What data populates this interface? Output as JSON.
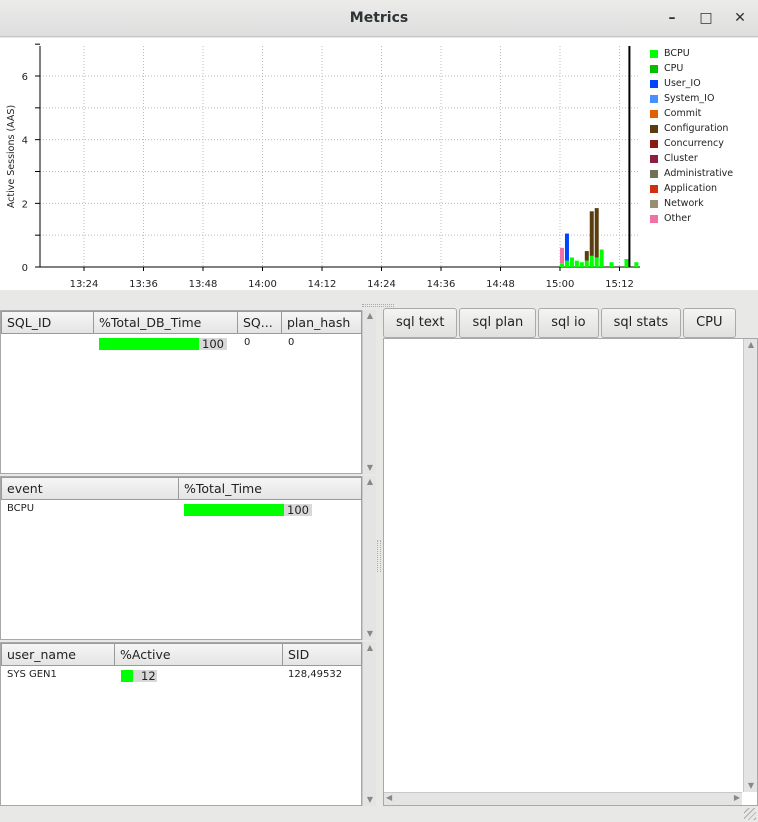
{
  "window": {
    "title": "Metrics",
    "minimize_glyph": "–",
    "maximize_glyph": "□",
    "close_glyph": "✕"
  },
  "chart_data": {
    "type": "bar",
    "title": "",
    "ylabel": "Active Sessions (AAS)",
    "xlabel": "",
    "ylim": [
      0,
      7
    ],
    "yticks": [
      0,
      2,
      4,
      6
    ],
    "xticks": [
      "13:24",
      "13:36",
      "13:48",
      "14:00",
      "14:12",
      "14:24",
      "14:36",
      "14:48",
      "15:00",
      "15:12"
    ],
    "legend": "right",
    "grid": true,
    "stacked": true,
    "series": [
      {
        "name": "BCPU",
        "color": "#00ff00"
      },
      {
        "name": "CPU",
        "color": "#00c000"
      },
      {
        "name": "User_IO",
        "color": "#0044ff"
      },
      {
        "name": "System_IO",
        "color": "#4a8fff"
      },
      {
        "name": "Commit",
        "color": "#e06000"
      },
      {
        "name": "Configuration",
        "color": "#5a3c10"
      },
      {
        "name": "Concurrency",
        "color": "#8b1a10"
      },
      {
        "name": "Cluster",
        "color": "#8b2040"
      },
      {
        "name": "Administrative",
        "color": "#707055"
      },
      {
        "name": "Application",
        "color": "#d03010"
      },
      {
        "name": "Network",
        "color": "#9a9070"
      },
      {
        "name": "Other",
        "color": "#f070a8"
      }
    ],
    "bars": [
      {
        "t": "15:00",
        "stack": {
          "Other": 0.5,
          "BCPU": 0.1
        }
      },
      {
        "t": "15:01",
        "stack": {
          "BCPU": 0.2,
          "User_IO": 0.85
        }
      },
      {
        "t": "15:02",
        "stack": {
          "BCPU": 0.3
        }
      },
      {
        "t": "15:03",
        "stack": {
          "BCPU": 0.2
        }
      },
      {
        "t": "15:04",
        "stack": {
          "BCPU": 0.15
        }
      },
      {
        "t": "15:05",
        "stack": {
          "BCPU": 0.2,
          "Configuration": 0.3
        }
      },
      {
        "t": "15:06",
        "stack": {
          "BCPU": 0.35,
          "Configuration": 1.4
        }
      },
      {
        "t": "15:07",
        "stack": {
          "BCPU": 0.3,
          "Configuration": 1.55
        }
      },
      {
        "t": "15:08",
        "stack": {
          "BCPU": 0.55
        }
      },
      {
        "t": "15:10",
        "stack": {
          "BCPU": 0.15
        }
      },
      {
        "t": "15:13",
        "stack": {
          "BCPU": 0.25
        }
      },
      {
        "t": "15:15",
        "stack": {
          "BCPU": 0.15
        }
      }
    ],
    "marker_time": "15:14"
  },
  "sql_table": {
    "headers": [
      "SQL_ID",
      "%Total_DB_Time",
      "SQ...",
      "plan_hash"
    ],
    "rows": [
      {
        "sql_id": "",
        "pct": 100,
        "pct_label": "100",
        "sq": "0",
        "plan_hash": "0"
      }
    ]
  },
  "event_table": {
    "headers": [
      "event",
      "%Total_Time"
    ],
    "rows": [
      {
        "event": "BCPU",
        "pct": 100,
        "pct_label": "100"
      }
    ]
  },
  "session_table": {
    "headers": [
      "user_name",
      "%Active",
      "SID"
    ],
    "rows": [
      {
        "user_name": "SYS GEN1",
        "pct": 12,
        "pct_label": "12",
        "sid": "128,49532"
      }
    ]
  },
  "tabs": [
    "sql text",
    "sql plan",
    "sql io",
    "sql stats",
    "CPU"
  ]
}
